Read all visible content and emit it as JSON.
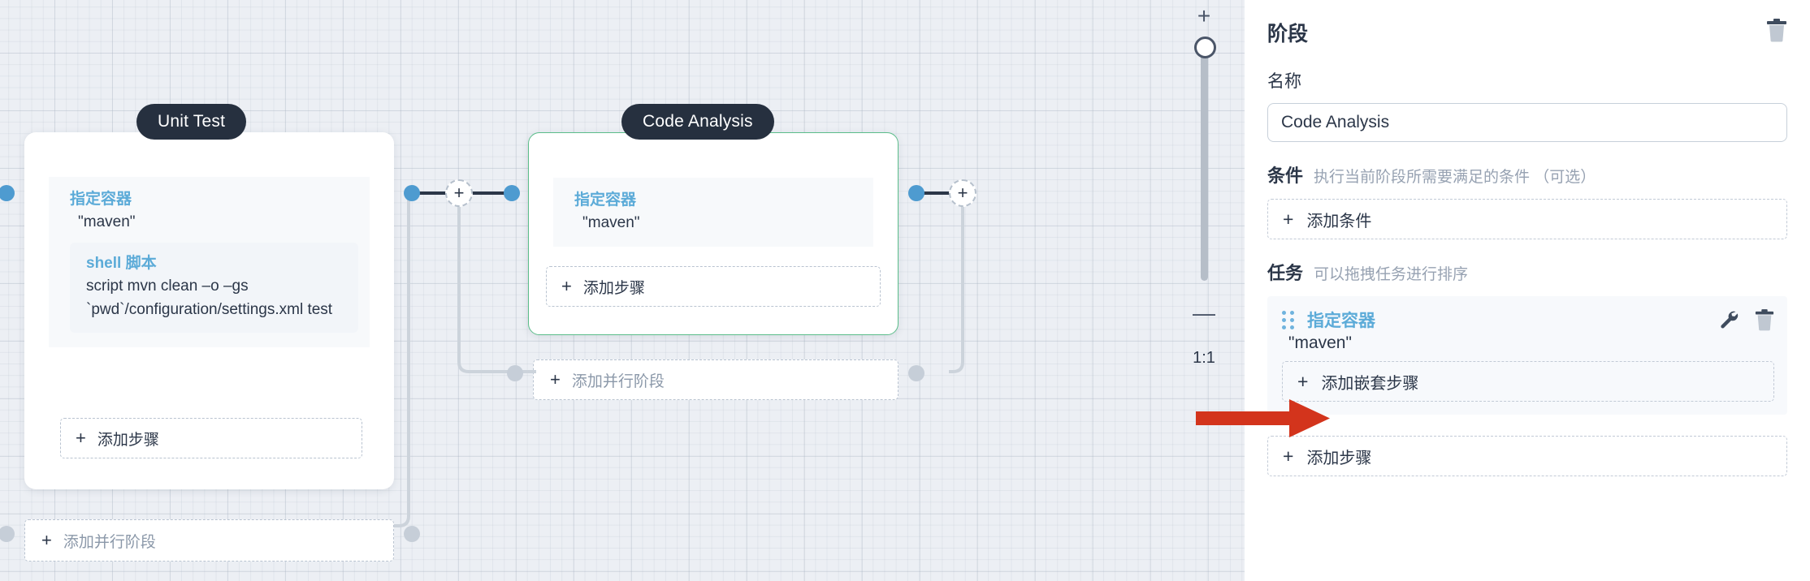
{
  "canvas": {
    "stages": [
      {
        "title": "Unit Test",
        "step": {
          "key": "指定容器",
          "value": "\"maven\"",
          "nested": {
            "key": "shell 脚本",
            "value": "script   mvn clean –o –gs `pwd`/configuration/settings.xml test"
          }
        },
        "add_step_label": "添加步骤"
      },
      {
        "title": "Code Analysis",
        "step": {
          "key": "指定容器",
          "value": "\"maven\""
        },
        "add_step_label": "添加步骤"
      }
    ],
    "add_parallel_stage_label": "添加并行阶段",
    "plus_glyph": "+"
  },
  "zoom": {
    "plus": "+",
    "minus": "—",
    "ratio": "1:1"
  },
  "panel": {
    "title": "阶段",
    "delete_icon": "trash-icon",
    "name_label": "名称",
    "name_value": "Code Analysis",
    "name_placeholder": "名称",
    "condition": {
      "title": "条件",
      "desc": "执行当前阶段所需要满足的条件 （可选）",
      "add_label": "添加条件"
    },
    "tasks": {
      "title": "任务",
      "desc": "可以拖拽任务进行排序",
      "items": [
        {
          "name": "指定容器",
          "value": "\"maven\"",
          "add_nested_label": "添加嵌套步骤",
          "settings_icon": "wrench-icon",
          "delete_icon": "trash-icon"
        }
      ],
      "add_step_label": "添加步骤"
    }
  },
  "annotation": {
    "arrow_color": "#d3341c",
    "arrow_name": "red-pointer-arrow"
  },
  "colors": {
    "accent_blue": "#5cabd8",
    "node_title_bg": "#26303f",
    "selected_border": "#5bbd8a",
    "dot_blue": "#4e9bd0",
    "dot_grey": "#c6ced8"
  }
}
